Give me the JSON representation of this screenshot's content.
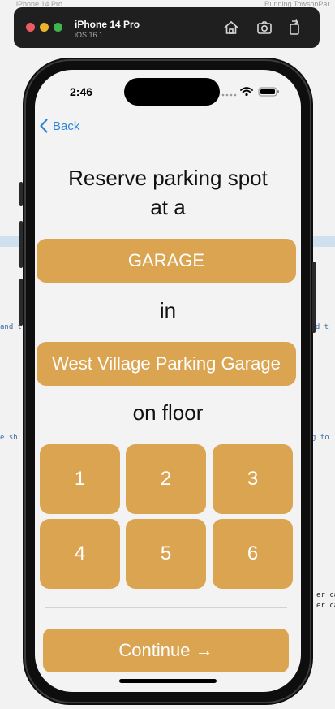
{
  "simulator": {
    "device_name": "iPhone 14 Pro",
    "os_version": "iOS 16.1",
    "bg_left_label": "iPhone 14 Pro",
    "bg_right_label": "Running TowsonPar",
    "bg_snippets": [
      "and t",
      "red t",
      "e sh",
      "g to",
      "er ca",
      "er ca"
    ]
  },
  "status_bar": {
    "time": "2:46"
  },
  "nav": {
    "back_label": "Back"
  },
  "content": {
    "heading_line1": "Reserve parking spot",
    "heading_line2": "at a",
    "type_value": "GARAGE",
    "connector_in": "in",
    "location_value": "West Village Parking Garage",
    "connector_floor": "on floor",
    "floors": [
      "1",
      "2",
      "3",
      "4",
      "5",
      "6"
    ],
    "continue_label": "Continue →"
  },
  "colors": {
    "accent": "#DBA451",
    "link": "#2F86D8",
    "screen_bg": "#F3F3F3"
  }
}
